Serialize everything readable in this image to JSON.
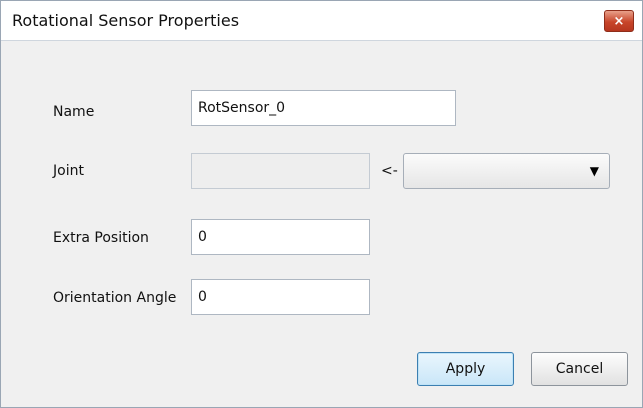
{
  "window": {
    "title": "Rotational Sensor Properties",
    "close_glyph": "×"
  },
  "form": {
    "name_label": "Name",
    "name_value": "RotSensor_0",
    "joint_label": "Joint",
    "joint_value": "",
    "joint_arrow": "<-",
    "joint_select_value": "",
    "extra_position_label": "Extra Position",
    "extra_position_value": "0",
    "orientation_angle_label": "Orientation Angle",
    "orientation_angle_value": "0"
  },
  "buttons": {
    "apply": "Apply",
    "cancel": "Cancel"
  },
  "icons": {
    "close": "close-icon",
    "dropdown": "chevron-down-icon"
  }
}
